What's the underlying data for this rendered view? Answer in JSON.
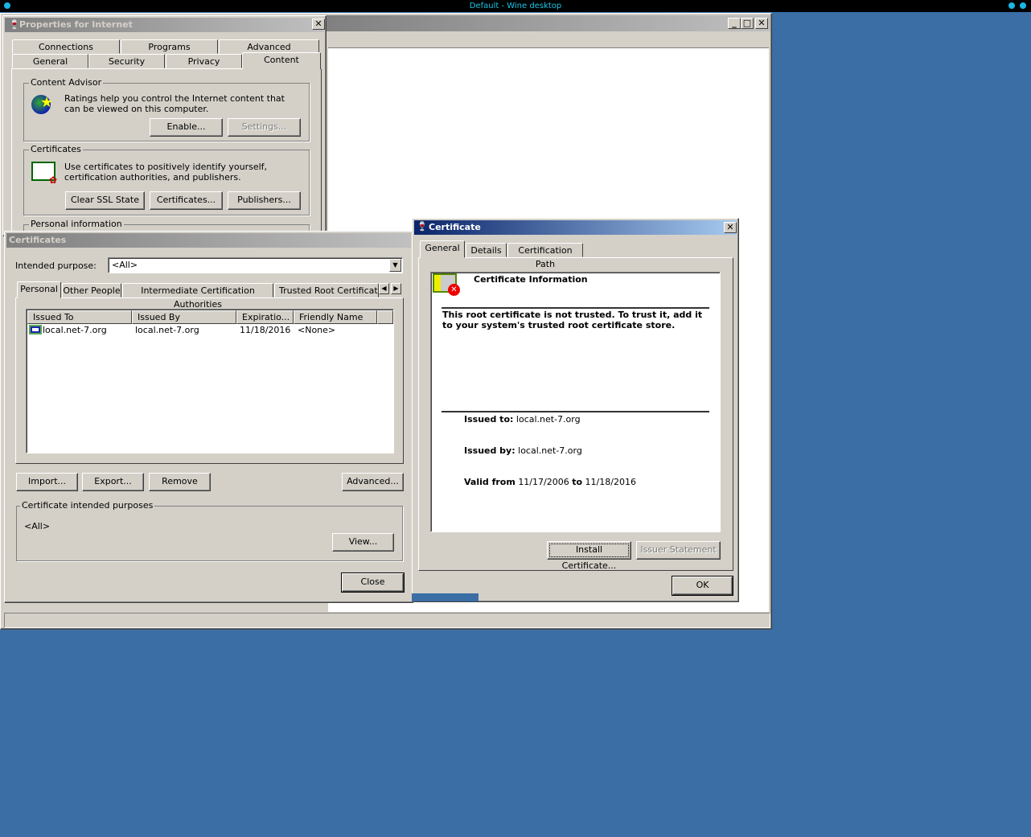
{
  "desktop": {
    "title": "Default - Wine desktop"
  },
  "properties": {
    "title": "Properties for Internet",
    "tabs_row1": [
      "Connections",
      "Programs",
      "Advanced"
    ],
    "tabs_row2": [
      "General",
      "Security",
      "Privacy",
      "Content"
    ],
    "content_advisor": {
      "label": "Content Advisor",
      "text": "Ratings help you control the Internet content that can be viewed on this computer.",
      "enable": "Enable...",
      "settings": "Settings..."
    },
    "certificates": {
      "label": "Certificates",
      "text": "Use certificates to positively identify yourself, certification authorities, and publishers.",
      "clear_ssl": "Clear SSL State",
      "certificates": "Certificates...",
      "publishers": "Publishers..."
    },
    "personal_info": {
      "label": "Personal information"
    }
  },
  "certs": {
    "title": "Certificates",
    "purpose_label": "Intended purpose:",
    "purpose_value": "<All>",
    "tabs": [
      "Personal",
      "Other People",
      "Intermediate Certification Authorities",
      "Trusted Root Certification"
    ],
    "columns": [
      "Issued To",
      "Issued By",
      "Expiratio...",
      "Friendly Name"
    ],
    "rows": [
      {
        "issued_to": "local.net-7.org",
        "issued_by": "local.net-7.org",
        "expiration": "11/18/2016",
        "friendly": "<None>"
      }
    ],
    "import": "Import...",
    "export": "Export...",
    "remove": "Remove",
    "advanced": "Advanced...",
    "purposes_label": "Certificate intended purposes",
    "purposes_value": "<All>",
    "view": "View...",
    "close": "Close"
  },
  "cert": {
    "title": "Certificate",
    "tabs": [
      "General",
      "Details",
      "Certification Path"
    ],
    "info_title": "Certificate Information",
    "warning": "This root certificate is not trusted.  To trust it, add it to your system's trusted root certificate store.",
    "issued_to_label": "Issued to:",
    "issued_to": "local.net-7.org",
    "issued_by_label": "Issued by:",
    "issued_by": "local.net-7.org",
    "valid_from_label": "Valid from",
    "valid_from": "11/17/2006",
    "to_label": "to",
    "valid_to": "11/18/2016",
    "install": "Install Certificate...",
    "issuer_statement": "Issuer Statement",
    "ok": "OK"
  }
}
